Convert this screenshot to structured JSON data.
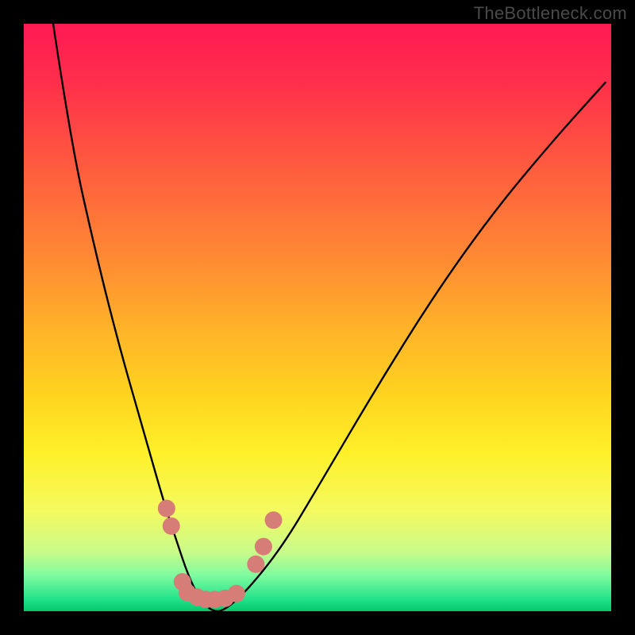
{
  "watermark": "TheBottleneck.com",
  "chart_data": {
    "type": "line",
    "title": "",
    "xlabel": "",
    "ylabel": "",
    "xlim": [
      0,
      100
    ],
    "ylim": [
      0,
      100
    ],
    "series": [
      {
        "name": "bottleneck-curve",
        "x": [
          5,
          8,
          12,
          16,
          20,
          24,
          26,
          28,
          30,
          32,
          34,
          38,
          44,
          50,
          60,
          70,
          80,
          90,
          99
        ],
        "values": [
          100,
          80,
          62,
          46,
          32,
          18,
          12,
          6,
          2,
          0,
          0,
          3.5,
          11,
          21,
          38,
          54,
          68,
          80,
          90
        ]
      }
    ],
    "highlight_points": {
      "name": "salmon-dots",
      "color": "#d77d78",
      "points": [
        {
          "x": 24.3,
          "y": 17.5
        },
        {
          "x": 25.1,
          "y": 14.5
        },
        {
          "x": 27.0,
          "y": 5.0
        },
        {
          "x": 27.8,
          "y": 3.2
        },
        {
          "x": 29.5,
          "y": 2.4
        },
        {
          "x": 31.0,
          "y": 2.0
        },
        {
          "x": 32.5,
          "y": 2.0
        },
        {
          "x": 34.3,
          "y": 2.2
        },
        {
          "x": 36.2,
          "y": 3.0
        },
        {
          "x": 39.5,
          "y": 8.0
        },
        {
          "x": 40.8,
          "y": 11.0
        },
        {
          "x": 42.5,
          "y": 15.5
        }
      ]
    },
    "gradient_stops": [
      {
        "pos": 0,
        "color": "#ff1a53"
      },
      {
        "pos": 24,
        "color": "#ff5a3f"
      },
      {
        "pos": 52,
        "color": "#ffb329"
      },
      {
        "pos": 73,
        "color": "#fff029"
      },
      {
        "pos": 94,
        "color": "#7dfba0"
      },
      {
        "pos": 100,
        "color": "#04c76b"
      }
    ]
  }
}
